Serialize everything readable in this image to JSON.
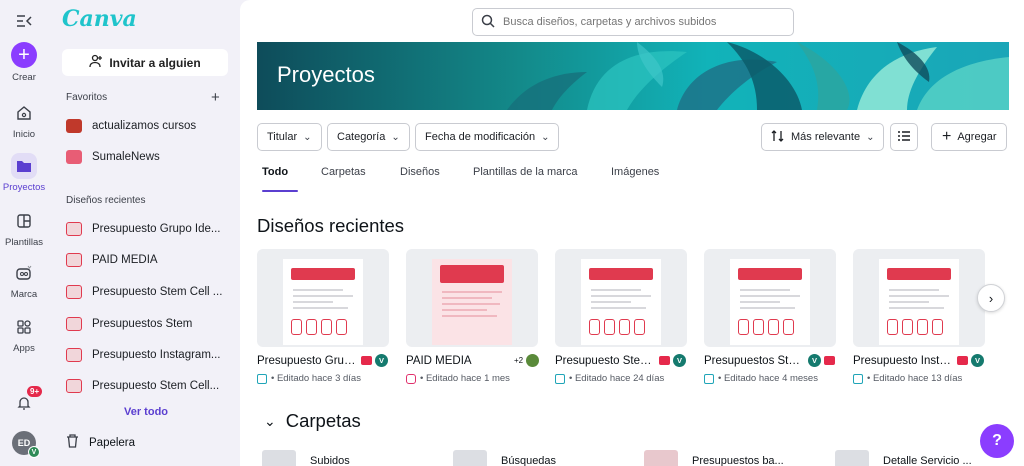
{
  "rail": {
    "create": "Crear",
    "items": [
      {
        "label": "Inicio"
      },
      {
        "label": "Proyectos"
      },
      {
        "label": "Plantillas"
      },
      {
        "label": "Marca"
      },
      {
        "label": "Apps"
      }
    ],
    "notifications_badge": "9+",
    "avatar_initials": "ED",
    "avatar_mini": "V"
  },
  "panel": {
    "logo": "Canva",
    "invite": "Invitar a alguien",
    "favorites_title": "Favoritos",
    "favorites": [
      {
        "label": "actualizamos cursos",
        "color": "#c0392b"
      },
      {
        "label": "SumaleNews",
        "color": "#e85d75"
      }
    ],
    "recent_title": "Diseños recientes",
    "recent": [
      {
        "label": "Presupuesto Grupo Ide..."
      },
      {
        "label": "PAID MEDIA"
      },
      {
        "label": "Presupuesto Stem Cell ..."
      },
      {
        "label": "Presupuestos Stem"
      },
      {
        "label": "Presupuesto Instagram..."
      },
      {
        "label": "Presupuesto Stem Cell..."
      }
    ],
    "see_all": "Ver todo",
    "trash": "Papelera"
  },
  "main": {
    "search_placeholder": "Busca diseños, carpetas y archivos subidos",
    "banner_title": "Proyectos",
    "filters": {
      "owner": "Titular",
      "category": "Categoría",
      "date": "Fecha de modificación",
      "sort": "Más relevante",
      "add": "Agregar"
    },
    "tabs": [
      "Todo",
      "Carpetas",
      "Diseños",
      "Plantillas de la marca",
      "Imágenes"
    ],
    "recent_heading": "Diseños recientes",
    "cards": [
      {
        "title": "Presupuesto Grup...",
        "meta": "• Editado hace 3 días",
        "collab": "V"
      },
      {
        "title": "PAID MEDIA",
        "meta": "• Editado hace 1 mes",
        "collab": "+2"
      },
      {
        "title": "Presupuesto Stem...",
        "meta": "• Editado hace 24 días",
        "collab": "V"
      },
      {
        "title": "Presupuestos Stem",
        "meta": "• Editado hace 4 meses",
        "collab": "V"
      },
      {
        "title": "Presupuesto Insta...",
        "meta": "• Editado hace 13 días",
        "collab": "V"
      }
    ],
    "folders_heading": "Carpetas",
    "folders": [
      "Subidos",
      "Búsquedas",
      "Presupuestos ba...",
      "Detalle Servicio ..."
    ]
  },
  "help": "?"
}
